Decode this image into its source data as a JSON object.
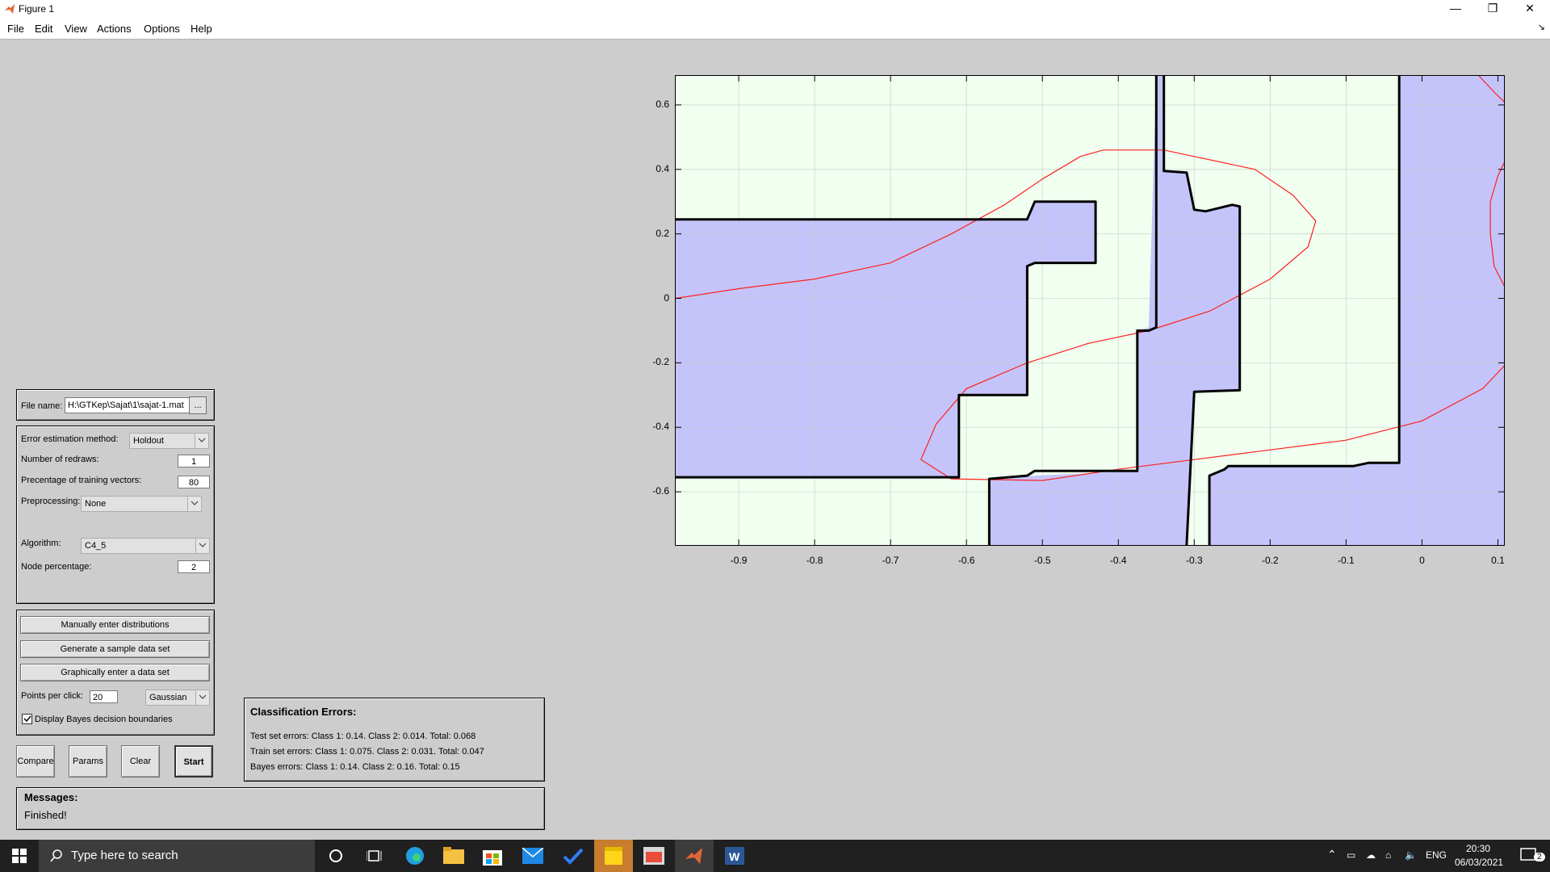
{
  "window": {
    "title": "Figure 1",
    "minimize": "—",
    "restore": "❐",
    "close": "✕"
  },
  "menu": [
    "File",
    "Edit",
    "View",
    "Actions",
    "Options",
    "Help"
  ],
  "file_panel": {
    "label": "File name:",
    "value": "H:\\GTKep\\Sajat\\1\\sajat-1.mat",
    "browse": "..."
  },
  "settings": {
    "error_method_label": "Error estimation method:",
    "error_method_value": "Holdout",
    "redraws_label": "Number of redraws:",
    "redraws_value": "1",
    "training_label": "Precentage of training vectors:",
    "training_value": "80",
    "preproc_label": "Preprocessing:",
    "preproc_value": "None",
    "algorithm_label": "Algorithm:",
    "algorithm_value": "C4_5",
    "node_label": "Node percentage:",
    "node_value": "2"
  },
  "data_panel": {
    "manual": "Manually enter distributions",
    "generate": "Generate a sample data set",
    "graphical": "Graphically enter a data set",
    "points_label": "Points per click:",
    "points_value": "20",
    "distribution": "Gaussian",
    "bayes_label": "Display Bayes decision boundaries",
    "bayes_checked": true
  },
  "buttons": {
    "compare": "Compare",
    "params": "Params",
    "clear": "Clear",
    "start": "Start"
  },
  "errors": {
    "title": "Classification Errors:",
    "test": "Test set errors: Class 1: 0.14. Class 2: 0.014. Total: 0.068",
    "train": "Train set errors: Class 1: 0.075. Class 2: 0.031. Total: 0.047",
    "bayes": "Bayes errors: Class 1: 0.14. Class 2: 0.16. Total: 0.15"
  },
  "messages": {
    "title": "Messages:",
    "text": "Finished!"
  },
  "plot": {
    "xlim": [
      -0.983,
      0.108
    ],
    "ylim": [
      -0.765,
      0.69
    ],
    "x_ticks": [
      "-0.9",
      "-0.8",
      "-0.7",
      "-0.6",
      "-0.5",
      "-0.4",
      "-0.3",
      "-0.2",
      "-0.1",
      "0",
      "0.1"
    ],
    "x_tick_values": [
      -0.9,
      -0.8,
      -0.7,
      -0.6,
      -0.5,
      -0.4,
      -0.3,
      -0.2,
      -0.1,
      0,
      0.1
    ],
    "y_ticks": [
      "0.6",
      "0.4",
      "0.2",
      "0",
      "-0.2",
      "-0.4",
      "-0.6"
    ],
    "y_tick_values": [
      0.6,
      0.4,
      0.2,
      0,
      -0.2,
      -0.4,
      -0.6
    ],
    "colors": {
      "region_a": "#f0fff0",
      "region_b": "#c4c4fa",
      "boundary": "#000000",
      "bayes": "#ff2020",
      "grid": "#c8c8c8"
    },
    "regions_b": [
      [
        [
          -0.983,
          0.245
        ],
        [
          -0.52,
          0.245
        ],
        [
          -0.51,
          0.3
        ],
        [
          -0.43,
          0.3
        ],
        [
          -0.43,
          0.11
        ],
        [
          -0.51,
          0.11
        ],
        [
          -0.52,
          0.1
        ],
        [
          -0.52,
          -0.3
        ],
        [
          -0.61,
          -0.3
        ],
        [
          -0.61,
          -0.555
        ],
        [
          -0.983,
          -0.555
        ]
      ],
      [
        [
          -0.35,
          0.69
        ],
        [
          -0.34,
          0.69
        ],
        [
          -0.34,
          0.395
        ],
        [
          -0.31,
          0.39
        ],
        [
          -0.3,
          0.275
        ],
        [
          -0.285,
          0.27
        ],
        [
          -0.25,
          0.29
        ],
        [
          -0.24,
          0.285
        ],
        [
          -0.24,
          -0.285
        ],
        [
          -0.3,
          -0.29
        ],
        [
          -0.31,
          -0.765
        ],
        [
          -0.57,
          -0.765
        ],
        [
          -0.57,
          -0.56
        ],
        [
          -0.51,
          -0.55
        ],
        [
          -0.375,
          -0.535
        ],
        [
          -0.375,
          -0.1
        ],
        [
          -0.36,
          -0.09
        ],
        [
          -0.35,
          0.69
        ]
      ],
      [
        [
          -0.03,
          0.69
        ],
        [
          0.108,
          0.69
        ],
        [
          0.108,
          -0.765
        ],
        [
          -0.28,
          -0.765
        ],
        [
          -0.28,
          -0.55
        ],
        [
          -0.26,
          -0.53
        ],
        [
          -0.255,
          -0.52
        ],
        [
          -0.09,
          -0.52
        ],
        [
          -0.07,
          -0.51
        ],
        [
          -0.03,
          -0.51
        ]
      ]
    ],
    "boundaries": [
      [
        [
          -0.983,
          0.245
        ],
        [
          -0.52,
          0.245
        ],
        [
          -0.51,
          0.3
        ],
        [
          -0.43,
          0.3
        ],
        [
          -0.43,
          0.11
        ],
        [
          -0.51,
          0.11
        ],
        [
          -0.52,
          0.1
        ],
        [
          -0.52,
          -0.3
        ],
        [
          -0.61,
          -0.3
        ],
        [
          -0.61,
          -0.555
        ],
        [
          -0.983,
          -0.555
        ]
      ],
      [
        [
          -0.35,
          0.69
        ],
        [
          -0.35,
          -0.09
        ],
        [
          -0.36,
          -0.1
        ],
        [
          -0.375,
          -0.1
        ],
        [
          -0.375,
          -0.535
        ],
        [
          -0.51,
          -0.535
        ],
        [
          -0.52,
          -0.55
        ],
        [
          -0.57,
          -0.56
        ],
        [
          -0.57,
          -0.765
        ]
      ],
      [
        [
          -0.34,
          0.69
        ],
        [
          -0.34,
          0.395
        ],
        [
          -0.31,
          0.39
        ],
        [
          -0.3,
          0.275
        ],
        [
          -0.285,
          0.27
        ],
        [
          -0.25,
          0.29
        ],
        [
          -0.24,
          0.285
        ],
        [
          -0.24,
          -0.285
        ],
        [
          -0.3,
          -0.29
        ],
        [
          -0.31,
          -0.765
        ]
      ],
      [
        [
          -0.03,
          0.69
        ],
        [
          -0.03,
          -0.51
        ],
        [
          -0.07,
          -0.51
        ],
        [
          -0.09,
          -0.52
        ],
        [
          -0.255,
          -0.52
        ],
        [
          -0.26,
          -0.53
        ],
        [
          -0.28,
          -0.55
        ],
        [
          -0.28,
          -0.765
        ]
      ]
    ],
    "bayes_curves": [
      [
        [
          -0.983,
          0.0
        ],
        [
          -0.9,
          0.03
        ],
        [
          -0.8,
          0.06
        ],
        [
          -0.7,
          0.11
        ],
        [
          -0.62,
          0.2
        ],
        [
          -0.55,
          0.29
        ],
        [
          -0.5,
          0.37
        ],
        [
          -0.45,
          0.44
        ],
        [
          -0.42,
          0.46
        ],
        [
          -0.34,
          0.46
        ],
        [
          -0.3,
          0.44
        ],
        [
          -0.22,
          0.4
        ],
        [
          -0.17,
          0.32
        ],
        [
          -0.14,
          0.24
        ],
        [
          -0.15,
          0.16
        ],
        [
          -0.2,
          0.06
        ],
        [
          -0.28,
          -0.04
        ],
        [
          -0.36,
          -0.1
        ],
        [
          -0.44,
          -0.14
        ],
        [
          -0.52,
          -0.2
        ],
        [
          -0.6,
          -0.28
        ],
        [
          -0.64,
          -0.39
        ],
        [
          -0.66,
          -0.5
        ],
        [
          -0.62,
          -0.56
        ],
        [
          -0.5,
          -0.565
        ],
        [
          -0.4,
          -0.53
        ],
        [
          -0.3,
          -0.5
        ],
        [
          -0.2,
          -0.47
        ],
        [
          -0.1,
          -0.44
        ],
        [
          0.0,
          -0.38
        ],
        [
          0.08,
          -0.28
        ],
        [
          0.108,
          -0.21
        ]
      ],
      [
        [
          0.075,
          0.69
        ],
        [
          0.095,
          0.64
        ],
        [
          0.108,
          0.61
        ]
      ],
      [
        [
          0.108,
          0.42
        ],
        [
          0.1,
          0.38
        ],
        [
          0.09,
          0.3
        ],
        [
          0.09,
          0.2
        ],
        [
          0.095,
          0.1
        ],
        [
          0.108,
          0.04
        ]
      ]
    ]
  },
  "taskbar": {
    "search_placeholder": "Type here to search",
    "lang": "ENG",
    "time": "20:30",
    "date": "06/03/2021",
    "notif_count": "2"
  }
}
